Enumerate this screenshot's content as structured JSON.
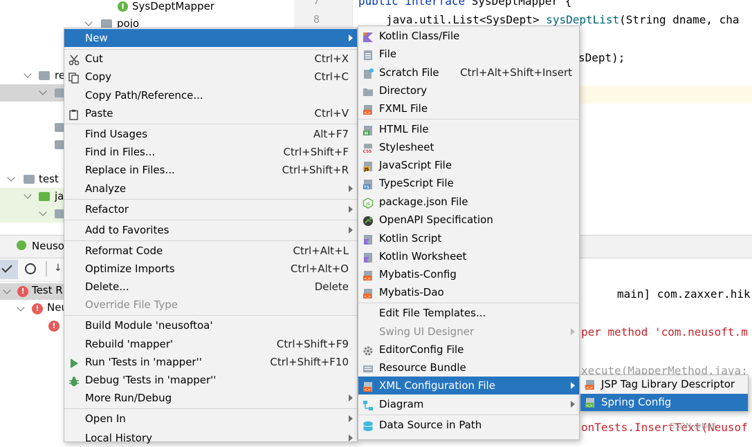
{
  "tree": {
    "items": [
      {
        "label": "SysDeptMapper"
      },
      {
        "label": "pojo"
      },
      {
        "label": "re"
      },
      {
        "label": "test"
      },
      {
        "label": "ja"
      }
    ]
  },
  "gutter": {
    "line7": "7",
    "line8": "8"
  },
  "editor": {
    "line1_kw": "public interface ",
    "line1_rest": "SysDeptMapper {",
    "line2_plain": "java.util.List<SysDept> ",
    "line2_fn": "sysDeptList",
    "line2_rest": "(String dname, cha",
    "line3": "sDept);"
  },
  "run": {
    "tab": "Neuso",
    "test_root": "Test R",
    "test_child": "Neu"
  },
  "console": {
    "line1": "main] com.zaxxer.hik",
    "line2": "per method 'com.neusoft.m",
    "line3": "xecute(MapperMethod.java:",
    "line5": "onTests.InsertText(Neusof"
  },
  "context_menu": {
    "new": "New",
    "cut": "Cut",
    "cut_sc": "Ctrl+X",
    "copy": "Copy",
    "copy_sc": "Ctrl+C",
    "copy_path": "Copy Path/Reference...",
    "paste": "Paste",
    "paste_sc": "Ctrl+V",
    "find_usages": "Find Usages",
    "find_usages_sc": "Alt+F7",
    "find_in_files": "Find in Files...",
    "find_in_files_sc": "Ctrl+Shift+F",
    "replace_in_files": "Replace in Files...",
    "replace_in_files_sc": "Ctrl+Shift+R",
    "analyze": "Analyze",
    "refactor": "Refactor",
    "add_to_favorites": "Add to Favorites",
    "reformat_code": "Reformat Code",
    "reformat_code_sc": "Ctrl+Alt+L",
    "optimize_imports": "Optimize Imports",
    "optimize_imports_sc": "Ctrl+Alt+O",
    "delete": "Delete...",
    "delete_sc": "Delete",
    "override_file_type": "Override File Type",
    "build_module": "Build Module 'neusoftoa'",
    "rebuild": "Rebuild 'mapper'",
    "rebuild_sc": "Ctrl+Shift+F9",
    "run_tests": "Run 'Tests in 'mapper''",
    "run_tests_sc": "Ctrl+Shift+F10",
    "debug_tests": "Debug 'Tests in 'mapper''",
    "more_run_debug": "More Run/Debug",
    "open_in": "Open In",
    "local_history": "Local History"
  },
  "new_menu": {
    "kotlin_class": "Kotlin Class/File",
    "file": "File",
    "scratch_file": "Scratch File",
    "scratch_file_sc": "Ctrl+Alt+Shift+Insert",
    "directory": "Directory",
    "fxml_file": "FXML File",
    "html_file": "HTML File",
    "stylesheet": "Stylesheet",
    "javascript_file": "JavaScript File",
    "typescript_file": "TypeScript File",
    "package_json": "package.json File",
    "openapi": "OpenAPI Specification",
    "kotlin_script": "Kotlin Script",
    "kotlin_worksheet": "Kotlin Worksheet",
    "mybatis_config": "Mybatis-Config",
    "mybatis_dao": "Mybatis-Dao",
    "edit_templates": "Edit File Templates...",
    "swing_ui": "Swing UI Designer",
    "editorconfig": "EditorConfig File",
    "resource_bundle": "Resource Bundle",
    "xml_config": "XML Configuration File",
    "diagram": "Diagram",
    "data_source": "Data Source in Path"
  },
  "xml_menu": {
    "jsp_tag": "JSP Tag Library Descriptor",
    "spring_config": "Spring Config"
  },
  "watermark": "CSDN @Neil"
}
